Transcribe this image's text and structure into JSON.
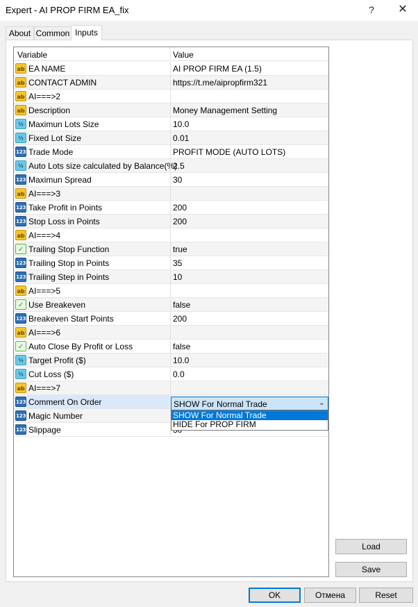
{
  "window": {
    "title": "Expert - AI PROP FIRM EA_fix",
    "help_glyph": "?",
    "close_glyph": "✕"
  },
  "tabs": [
    {
      "label": "About"
    },
    {
      "label": "Common"
    },
    {
      "label": "Inputs",
      "active": true
    }
  ],
  "grid": {
    "columns": {
      "variable": "Variable",
      "value": "Value"
    },
    "rows": [
      {
        "type": "ab",
        "name": "EA NAME",
        "value": "AI PROP FIRM EA (1.5)"
      },
      {
        "type": "ab",
        "name": "CONTACT ADMIN",
        "value": "https://t.me/aipropfirm321"
      },
      {
        "type": "ab",
        "name": "AI===>2",
        "value": ""
      },
      {
        "type": "ab",
        "name": "Description",
        "value": "Money Management Setting"
      },
      {
        "type": "half",
        "name": "Maximun Lots Size",
        "value": "10.0"
      },
      {
        "type": "half",
        "name": "Fixed Lot Size",
        "value": "0.01"
      },
      {
        "type": "n123",
        "name": "Trade Mode",
        "value": "PROFIT MODE (AUTO LOTS)"
      },
      {
        "type": "half",
        "name": "Auto Lots size calculated by Balance(%)",
        "value": "2.5"
      },
      {
        "type": "n123",
        "name": "Maximun Spread",
        "value": "30"
      },
      {
        "type": "ab",
        "name": "AI===>3",
        "value": ""
      },
      {
        "type": "n123",
        "name": "Take Profit in Points",
        "value": "200"
      },
      {
        "type": "n123",
        "name": "Stop Loss in Points",
        "value": "200"
      },
      {
        "type": "ab",
        "name": "AI===>4",
        "value": ""
      },
      {
        "type": "bool",
        "name": "Trailing Stop Function",
        "value": "true"
      },
      {
        "type": "n123",
        "name": "Trailing Stop in Points",
        "value": "35"
      },
      {
        "type": "n123",
        "name": "Trailing Step in Points",
        "value": "10"
      },
      {
        "type": "ab",
        "name": "AI===>5",
        "value": ""
      },
      {
        "type": "bool",
        "name": "Use Breakeven",
        "value": "false"
      },
      {
        "type": "n123",
        "name": "Breakeven Start Points",
        "value": "200"
      },
      {
        "type": "ab",
        "name": "AI===>6",
        "value": ""
      },
      {
        "type": "bool",
        "name": "Auto Close By Profit or Loss",
        "value": "false"
      },
      {
        "type": "half",
        "name": "Target Profit ($)",
        "value": "10.0"
      },
      {
        "type": "half",
        "name": "Cut Loss ($)",
        "value": "0.0"
      },
      {
        "type": "ab",
        "name": "AI===>7",
        "value": ""
      },
      {
        "type": "n123",
        "name": "Comment On Order",
        "value": "SHOW For Normal Trade",
        "selected": true
      },
      {
        "type": "n123",
        "name": "Magic Number",
        "value": ""
      },
      {
        "type": "n123",
        "name": "Slippage",
        "value": "30"
      }
    ]
  },
  "icon_labels": {
    "ab": "ab",
    "n123": "123",
    "half": "½",
    "bool": "✓"
  },
  "combo": {
    "value": "SHOW For Normal Trade",
    "arrow": "⌄",
    "options": [
      "SHOW For Normal Trade",
      "HIDE For PROP FIRM"
    ]
  },
  "buttons": {
    "load": "Load",
    "save": "Save",
    "ok": "OK",
    "cancel": "Отмена",
    "reset": "Reset"
  }
}
